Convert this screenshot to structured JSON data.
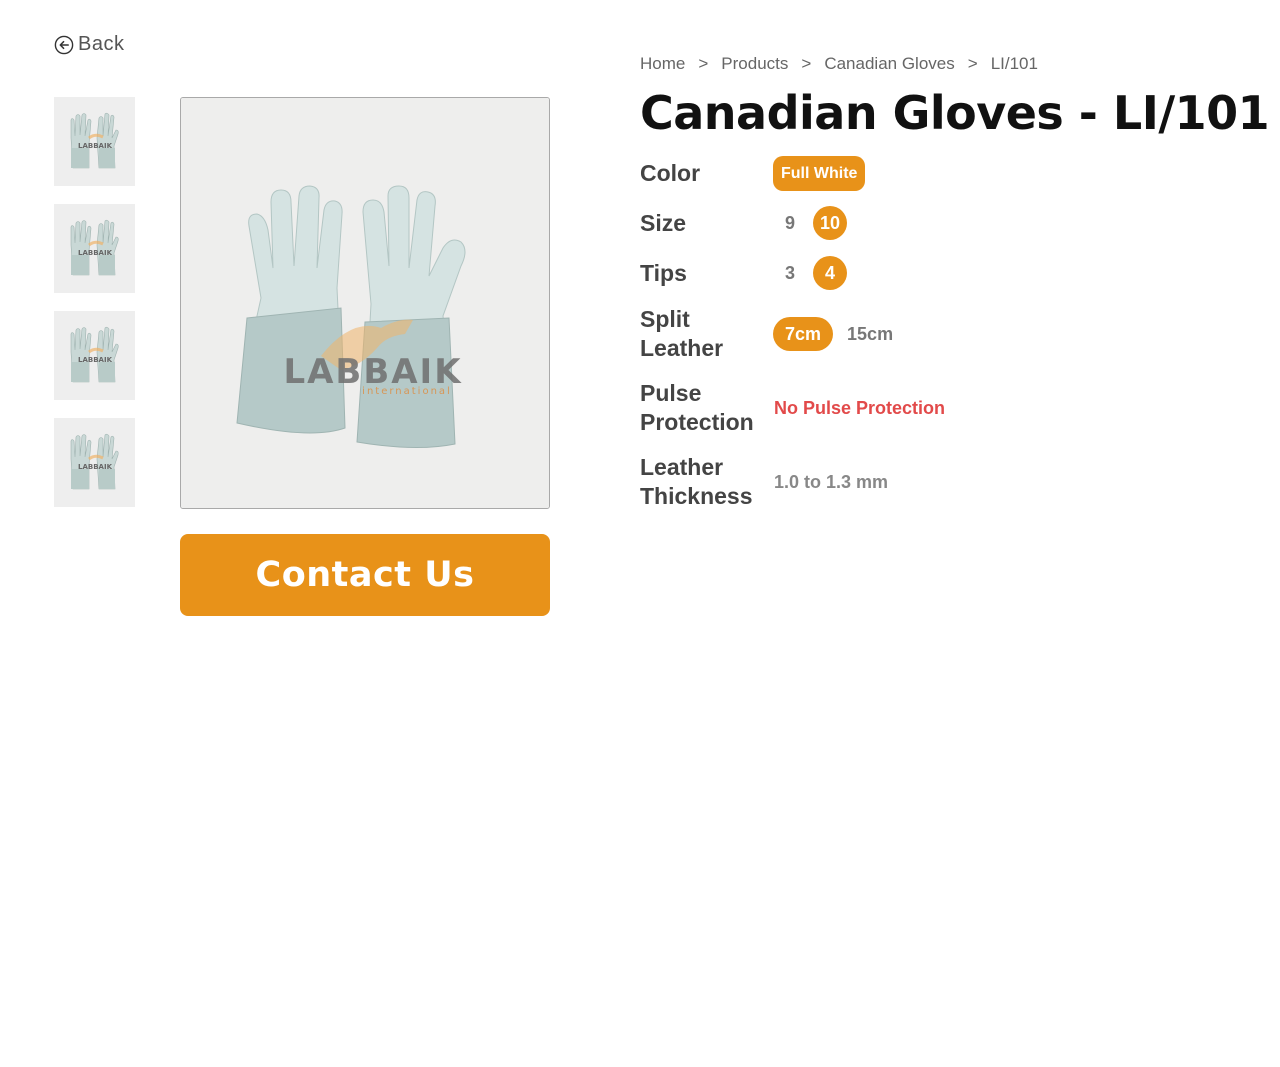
{
  "nav": {
    "back_label": "Back"
  },
  "breadcrumb": {
    "items": [
      "Home",
      "Products",
      "Canadian Gloves"
    ],
    "separator": ">",
    "current": "LI/101"
  },
  "product": {
    "title": "Canadian Gloves - LI/101",
    "image_watermark": "LABBAIK",
    "image_watermark_sub": "international",
    "thumbnail_count": 4
  },
  "actions": {
    "contact_label": "Contact Us"
  },
  "specs": {
    "color": {
      "label": "Color",
      "options": [
        "Full White"
      ],
      "selected": "Full White"
    },
    "size": {
      "label": "Size",
      "options": [
        "9",
        "10"
      ],
      "selected": "10"
    },
    "tips": {
      "label": "Tips",
      "options": [
        "3",
        "4"
      ],
      "selected": "4"
    },
    "split_leather": {
      "label_line1": "Split",
      "label_line2": "Leather",
      "options": [
        "7cm",
        "15cm"
      ],
      "selected": "7cm"
    },
    "pulse_protection": {
      "label_line1": "Pulse",
      "label_line2": "Protection",
      "value": "No Pulse Protection"
    },
    "leather_thickness": {
      "label_line1": "Leather",
      "label_line2": "Thickness",
      "value": "1.0 to 1.3 mm"
    }
  },
  "colors": {
    "accent": "#e89219",
    "alert": "#e24a4a",
    "text_dark": "#111111",
    "text_muted": "#777777"
  },
  "icons": {
    "back": "arrow-left-circle-icon"
  }
}
